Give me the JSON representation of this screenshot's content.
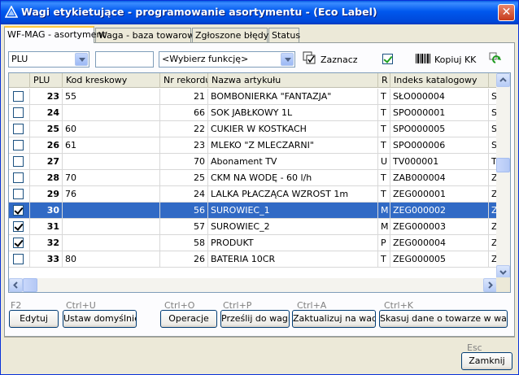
{
  "window": {
    "title": "Wagi etykietujące - programowanie asortymentu - (Eco Label)",
    "close_glyph": "✕"
  },
  "tabs": [
    {
      "label": "WF-MAG - asortyment",
      "active": true
    },
    {
      "label": "Waga - baza towarowa",
      "active": false
    },
    {
      "label": "Zgłoszone błędy",
      "active": false
    },
    {
      "label": "Status",
      "active": false
    }
  ],
  "toolbar": {
    "field_select": "PLU",
    "search_value": "",
    "function_select": "<Wybierz funkcję>",
    "select_label": "Zaznacz",
    "copy_kk_label": "Kopiuj KK",
    "copy_kk_checked": true
  },
  "grid": {
    "columns": [
      "PLU",
      "Kod kreskowy",
      "Nr rekordu",
      "Nazwa artykułu",
      "R",
      "Indeks katalogowy",
      ""
    ],
    "rows": [
      {
        "checked": false,
        "plu": "23",
        "barcode": "55",
        "record": "21",
        "name": "BOMBONIERKA \"FANTAZJA\"",
        "r": "T",
        "index": "SŁO000004",
        "extra": "S"
      },
      {
        "checked": false,
        "plu": "24",
        "barcode": "",
        "record": "66",
        "name": "SOK JABŁKOWY 1L",
        "r": "T",
        "index": "SPO000001",
        "extra": "S"
      },
      {
        "checked": false,
        "plu": "25",
        "barcode": "60",
        "record": "22",
        "name": "CUKIER W KOSTKACH",
        "r": "T",
        "index": "SPO000005",
        "extra": "S"
      },
      {
        "checked": false,
        "plu": "26",
        "barcode": "61",
        "record": "23",
        "name": "MLEKO \"Z MLECZARNI\"",
        "r": "T",
        "index": "SPO000006",
        "extra": "S"
      },
      {
        "checked": false,
        "plu": "27",
        "barcode": "",
        "record": "70",
        "name": "Abonament TV",
        "r": "U",
        "index": "TV000001",
        "extra": "T"
      },
      {
        "checked": false,
        "plu": "28",
        "barcode": "70",
        "record": "25",
        "name": "CKM NA WODĘ - 60 l/h",
        "r": "T",
        "index": "ZAB000004",
        "extra": "Z"
      },
      {
        "checked": false,
        "plu": "29",
        "barcode": "76",
        "record": "24",
        "name": "LALKA PŁACZĄCA WZROST 1m",
        "r": "T",
        "index": "ZEG000001",
        "extra": "Z"
      },
      {
        "checked": true,
        "plu": "30",
        "barcode": "",
        "record": "56",
        "name": "SUROWIEC_1",
        "r": "M",
        "index": "ZEG000002",
        "extra": "Z",
        "selected": true
      },
      {
        "checked": true,
        "plu": "31",
        "barcode": "",
        "record": "57",
        "name": "SUROWIEC_2",
        "r": "M",
        "index": "ZEG000003",
        "extra": "Z"
      },
      {
        "checked": true,
        "plu": "32",
        "barcode": "",
        "record": "58",
        "name": "PRODUKT",
        "r": "P",
        "index": "ZEG000004",
        "extra": "Z"
      },
      {
        "checked": false,
        "plu": "33",
        "barcode": "80",
        "record": "26",
        "name": "BATERIA 10CR",
        "r": "T",
        "index": "ZEG000005",
        "extra": "Z"
      }
    ]
  },
  "actions": [
    {
      "hint": "F2",
      "label": "Edytuj"
    },
    {
      "hint": "Ctrl+U",
      "label": "Ustaw domyślnie"
    },
    {
      "hint": "Ctrl+O",
      "label": "Operacje"
    },
    {
      "hint": "Ctrl+P",
      "label": "Prześlij do wagi"
    },
    {
      "hint": "Ctrl+A",
      "label": "Zaktualizuj na wadze"
    },
    {
      "hint": "Ctrl+K",
      "label": "Skasuj dane o towarze w wadze"
    }
  ],
  "footer": {
    "hint": "Esc",
    "close_label": "Zamknij"
  },
  "icons": {
    "app": "triangle-app-icon",
    "select_all": "checkboxes-icon",
    "copy_kk": "barcode-icon",
    "refresh": "refresh-icon"
  }
}
